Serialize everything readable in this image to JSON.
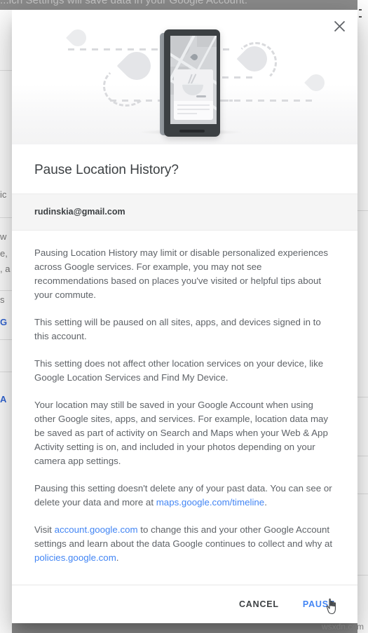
{
  "background": {
    "top_text": "...ich Settings will save data in your Google Account.",
    "left_fragments": [
      "ic",
      "w",
      "e,",
      ", a",
      "s",
      "G",
      "A"
    ],
    "scrim_color": "#8c8c8c"
  },
  "dialog": {
    "close_icon": "close-icon",
    "title": "Pause Location History?",
    "account_email": "rudinskia@gmail.com",
    "illustration": {
      "name": "location-history-illustration",
      "description": "phone showing a map with a location pin and a food card, surrounded by map pins connected by dashed route lines"
    },
    "paragraphs": [
      {
        "id": "p1",
        "text": "Pausing Location History may limit or disable personalized experiences across Google services. For example, you may not see recommendations based on places you've visited or helpful tips about your commute."
      },
      {
        "id": "p2",
        "text": "This setting will be paused on all sites, apps, and devices signed in to this account."
      },
      {
        "id": "p3",
        "text": "This setting does not affect other location services on your device, like Google Location Services and Find My Device."
      },
      {
        "id": "p4",
        "text": "Your location may still be saved in your Google Account when using other Google sites, apps, and services. For example, location data may be saved as part of activity on Search and Maps when your Web & App Activity setting is on, and included in your photos depending on your camera app settings."
      },
      {
        "id": "p5",
        "prefix": "Pausing this setting doesn't delete any of your past data. You can see or delete your data and more at ",
        "link": "maps.google.com/timeline",
        "suffix": "."
      },
      {
        "id": "p6",
        "prefix": "Visit ",
        "link1": "account.google.com",
        "middle": " to change this and your other Google Account settings and learn about the data Google continues to collect and why at ",
        "link2": "policies.google.com",
        "suffix": "."
      }
    ],
    "footer": {
      "cancel_label": "CANCEL",
      "pause_label": "PAUSE"
    }
  },
  "cursor": {
    "type": "pointer-hand-cursor"
  },
  "watermark": {
    "text": "wsxdn.com"
  },
  "colors": {
    "link": "#4285f4",
    "title_text": "#3c4043",
    "body_text": "#5f6368",
    "account_row_bg": "#f5f5f5"
  }
}
